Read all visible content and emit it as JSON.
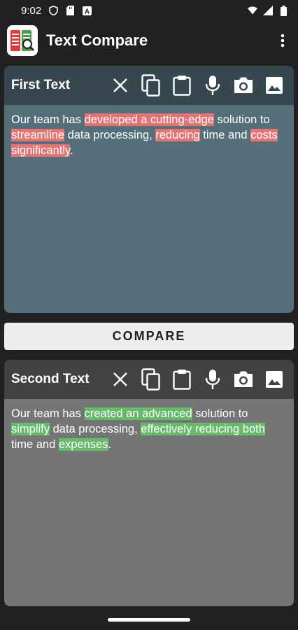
{
  "status_bar": {
    "time": "9:02",
    "icons": [
      "shield-icon",
      "sd-card-icon",
      "a-badge-icon"
    ],
    "right_icons": [
      "wifi-icon",
      "signal-icon",
      "battery-icon"
    ]
  },
  "app_bar": {
    "title": "Text Compare",
    "logo_icon": "text-compare-logo",
    "menu_icon": "more-vert-icon"
  },
  "toolbar_icons": [
    "clear-icon",
    "copy-icon",
    "paste-icon",
    "mic-icon",
    "camera-icon",
    "image-icon"
  ],
  "first_text": {
    "title": "First Text",
    "segments": [
      {
        "text": "Our team has ",
        "diff": "none"
      },
      {
        "text": "developed a cutting-edge",
        "diff": "del"
      },
      {
        "text": " solution to ",
        "diff": "none"
      },
      {
        "text": "streamline",
        "diff": "del"
      },
      {
        "text": " data processing, ",
        "diff": "none"
      },
      {
        "text": "reducing",
        "diff": "del"
      },
      {
        "text": " time and ",
        "diff": "none"
      },
      {
        "text": "costs significantly",
        "diff": "del"
      },
      {
        "text": ".",
        "diff": "none"
      }
    ]
  },
  "compare_button": {
    "label": "COMPARE"
  },
  "second_text": {
    "title": "Second Text",
    "segments": [
      {
        "text": "Our team has ",
        "diff": "none"
      },
      {
        "text": "created an advanced",
        "diff": "add"
      },
      {
        "text": " solution to ",
        "diff": "none"
      },
      {
        "text": "simplify",
        "diff": "add"
      },
      {
        "text": " data processing, ",
        "diff": "none"
      },
      {
        "text": "effectively reducing both",
        "diff": "add"
      },
      {
        "text": " time and ",
        "diff": "none"
      },
      {
        "text": "expenses",
        "diff": "add"
      },
      {
        "text": ".",
        "diff": "none"
      }
    ]
  },
  "colors": {
    "deleted_highlight": "#e57373",
    "added_highlight": "#66bb6a",
    "first_panel": "#546e7a",
    "second_panel": "#757575"
  }
}
